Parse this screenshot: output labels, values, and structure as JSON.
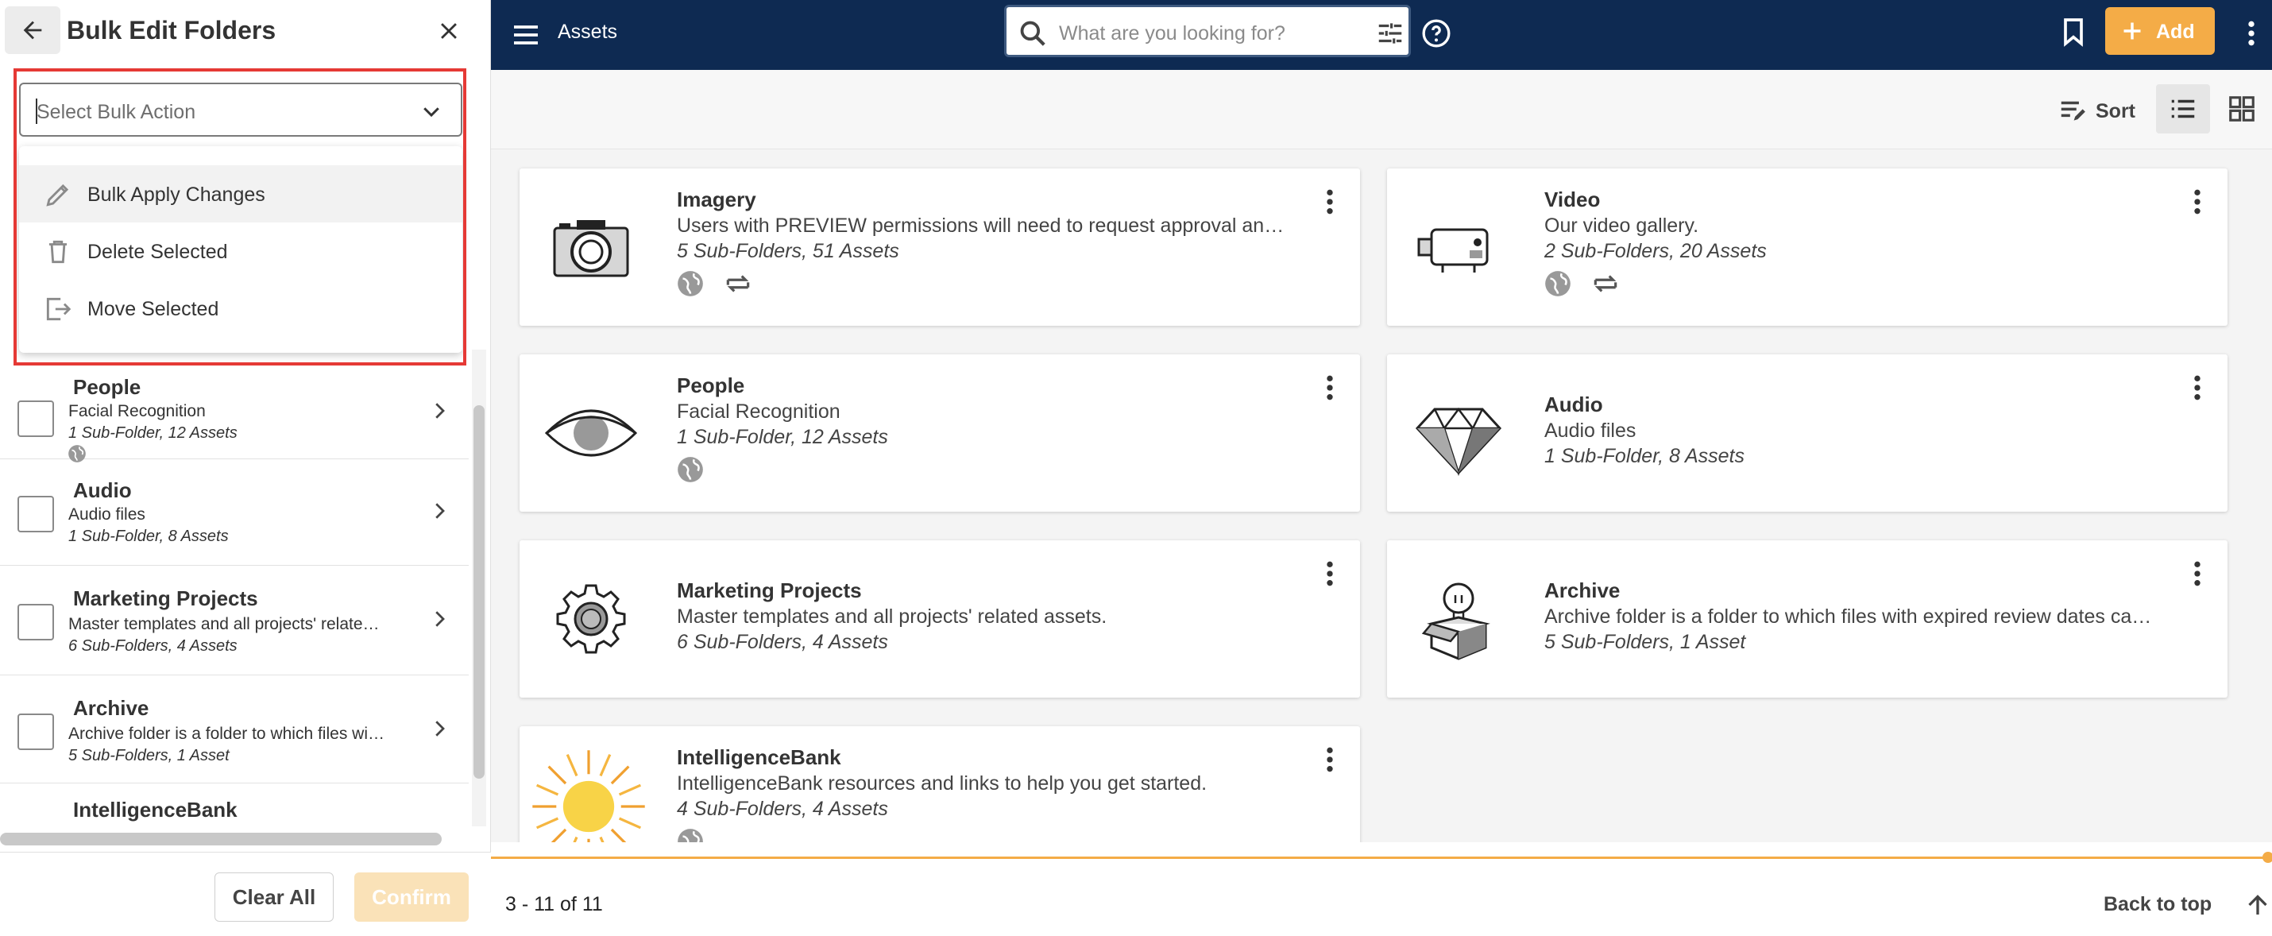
{
  "panel": {
    "title": "Bulk Edit Folders",
    "select_placeholder": "Select Bulk Action",
    "menu": [
      {
        "label": "Bulk Apply Changes",
        "icon": "pencil-icon"
      },
      {
        "label": "Delete Selected",
        "icon": "trash-icon"
      },
      {
        "label": "Move Selected",
        "icon": "move-icon"
      }
    ],
    "folders": [
      {
        "name": "People",
        "desc": "Facial Recognition",
        "count": "1 Sub-Folder, 12 Assets"
      },
      {
        "name": "Audio",
        "desc": "Audio files",
        "count": "1 Sub-Folder, 8 Assets"
      },
      {
        "name": "Marketing Projects",
        "desc": "Master templates and all projects' relate…",
        "count": "6 Sub-Folders, 4 Assets"
      },
      {
        "name": "Archive",
        "desc": "Archive folder is a folder to which files wi…",
        "count": "5 Sub-Folders, 1 Asset"
      },
      {
        "name": "IntelligenceBank"
      }
    ],
    "clear_label": "Clear All",
    "confirm_label": "Confirm"
  },
  "topbar": {
    "title": "Assets",
    "search_placeholder": "What are you looking for?",
    "add_label": "Add"
  },
  "toolbar": {
    "sort_label": "Sort"
  },
  "cards": [
    {
      "title": "Imagery",
      "desc": "Users with PREVIEW permissions will need to request approval an…",
      "count": "5 Sub-Folders, 51 Assets",
      "icon": "camera-icon"
    },
    {
      "title": "Video",
      "desc": "Our video gallery.",
      "count": "2 Sub-Folders, 20 Assets",
      "icon": "video-camera-icon"
    },
    {
      "title": "People",
      "desc": "Facial Recognition",
      "count": "1 Sub-Folder, 12 Assets",
      "icon": "eye-icon"
    },
    {
      "title": "Audio",
      "desc": "Audio files",
      "count": "1 Sub-Folder, 8 Assets",
      "icon": "diamond-icon"
    },
    {
      "title": "Marketing Projects",
      "desc": "Master templates and all projects' related assets.",
      "count": "6 Sub-Folders, 4 Assets",
      "icon": "gear-icon"
    },
    {
      "title": "Archive",
      "desc": "Archive folder is a folder to which files with expired review dates ca…",
      "count": "5 Sub-Folders, 1 Asset",
      "icon": "lightbulb-box-icon"
    },
    {
      "title": "IntelligenceBank",
      "desc": "IntelligenceBank resources and links to help you get started.",
      "count": "4 Sub-Folders, 4 Assets",
      "icon": "sun-icon"
    }
  ],
  "footer": {
    "pagination": "3 - 11 of 11",
    "back_to_top": "Back to top"
  },
  "colors": {
    "topbar": "#0e2a52",
    "accent": "#f4ac47",
    "highlight": "#e53935"
  }
}
